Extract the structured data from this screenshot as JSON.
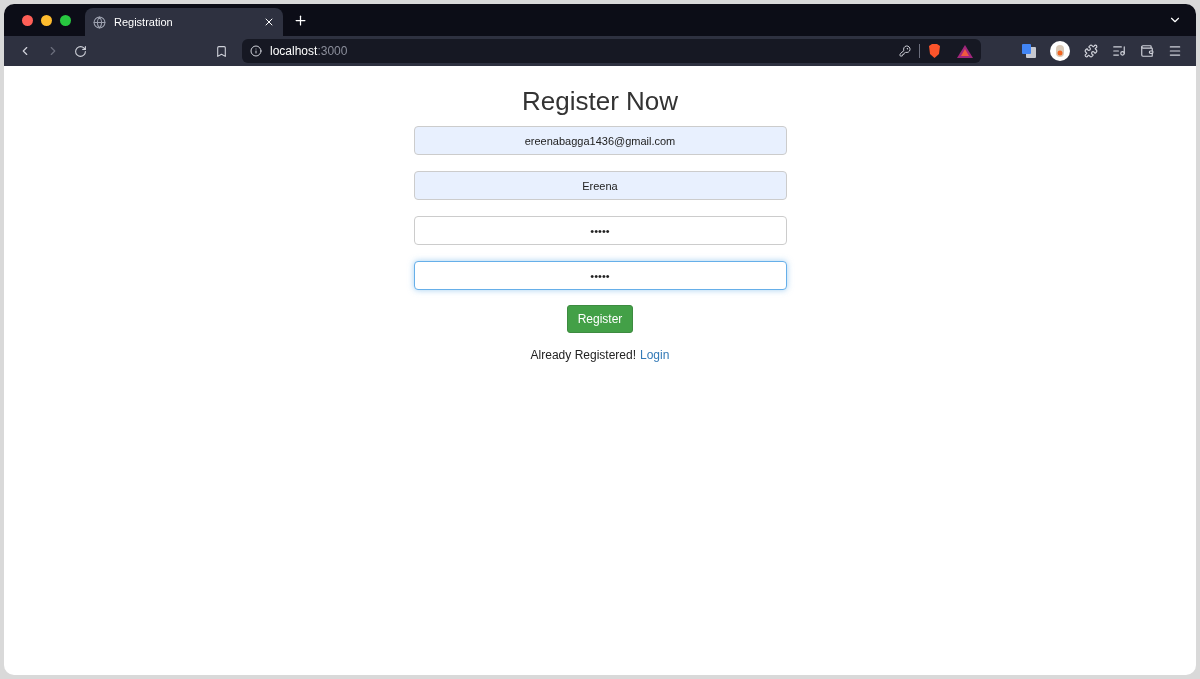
{
  "browser": {
    "tab": {
      "title": "Registration",
      "selected": true
    },
    "url": {
      "host": "localhost",
      "port": ":3000"
    }
  },
  "page": {
    "heading": "Register Now",
    "fields": [
      {
        "value": "ereenabagga1436@gmail.com",
        "autofilled": true,
        "focused": false
      },
      {
        "value": "Ereena",
        "autofilled": true,
        "focused": false
      },
      {
        "value": "•••••",
        "autofilled": false,
        "focused": false
      },
      {
        "value": "•••••",
        "autofilled": false,
        "focused": true
      }
    ],
    "button": "Register",
    "prompt": "Already Registered!",
    "link": "Login"
  }
}
